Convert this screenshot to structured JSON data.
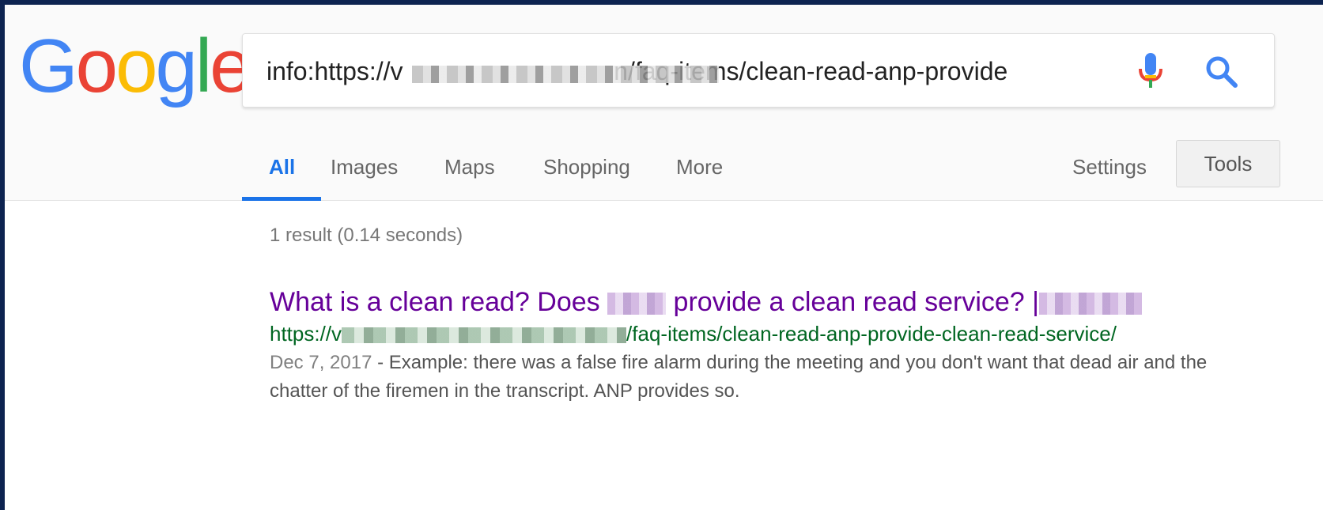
{
  "logo": {
    "letters": [
      "G",
      "o",
      "o",
      "g",
      "l",
      "e"
    ]
  },
  "search": {
    "query": "info:https://v                              n/faq-items/clean-read-anp-provide"
  },
  "icons": {
    "mic": "mic-icon",
    "search": "search-icon"
  },
  "tabs": [
    {
      "label": "All"
    },
    {
      "label": "Images"
    },
    {
      "label": "Maps"
    },
    {
      "label": "Shopping"
    },
    {
      "label": "More"
    }
  ],
  "settings_label": "Settings",
  "tools_label": "Tools",
  "stats": "1 result (0.14 seconds)",
  "result": {
    "title_part1": "What is a clean read? Does ",
    "title_part2": " provide a clean read service? |",
    "url_prefix": "https://v",
    "url_suffix": "/faq-items/clean-read-anp-provide-clean-read-service/",
    "date": "Dec 7, 2017",
    "snippet": " - Example: there was a false fire alarm during the meeting and you don't want that dead air and the chatter of the firemen in the transcript. ANP provides so."
  },
  "colors": {
    "accent": "#1a73e8",
    "visited_link": "#660099",
    "url_green": "#006621"
  }
}
